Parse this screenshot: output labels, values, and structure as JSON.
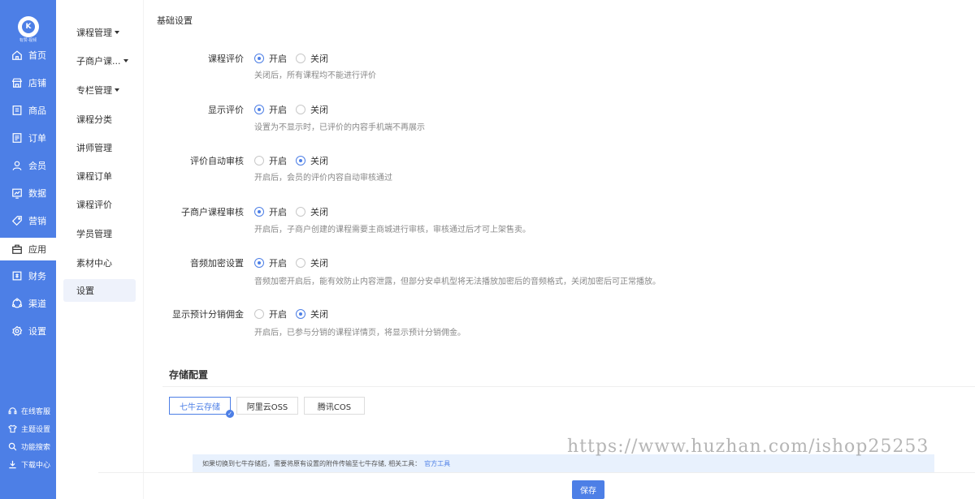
{
  "brand": {
    "logo_text": "有赞·视频",
    "logo_glyph": "K"
  },
  "primary_nav": [
    {
      "label": "首页",
      "icon": "home-icon"
    },
    {
      "label": "店铺",
      "icon": "store-icon"
    },
    {
      "label": "商品",
      "icon": "goods-icon"
    },
    {
      "label": "订单",
      "icon": "order-icon"
    },
    {
      "label": "会员",
      "icon": "member-icon"
    },
    {
      "label": "数据",
      "icon": "data-icon"
    },
    {
      "label": "营销",
      "icon": "tag-icon"
    },
    {
      "label": "应用",
      "icon": "app-icon"
    },
    {
      "label": "财务",
      "icon": "finance-icon"
    },
    {
      "label": "渠道",
      "icon": "channel-icon"
    },
    {
      "label": "设置",
      "icon": "gear-icon"
    }
  ],
  "bottom_nav": [
    {
      "label": "在线客服",
      "icon": "headset-icon"
    },
    {
      "label": "主题设置",
      "icon": "shirt-icon"
    },
    {
      "label": "功能搜索",
      "icon": "search-icon"
    },
    {
      "label": "下载中心",
      "icon": "download-icon"
    }
  ],
  "secondary_nav": [
    {
      "label": "课程管理"
    },
    {
      "label": "子商户课..."
    },
    {
      "label": "专栏管理"
    },
    {
      "label": "课程分类"
    },
    {
      "label": "讲师管理"
    },
    {
      "label": "课程订单"
    },
    {
      "label": "课程评价"
    },
    {
      "label": "学员管理"
    },
    {
      "label": "素材中心"
    },
    {
      "label": "设置"
    }
  ],
  "basic": {
    "title": "基础设置",
    "on_label": "开启",
    "off_label": "关闭",
    "rows": [
      {
        "label": "课程评价",
        "value": "开启",
        "hint": "关闭后，所有课程均不能进行评价"
      },
      {
        "label": "显示评价",
        "value": "开启",
        "hint": "设置为不显示时，已评价的内容手机端不再展示"
      },
      {
        "label": "评价自动审核",
        "value": "关闭",
        "hint": "开启后，会员的评价内容自动审核通过"
      },
      {
        "label": "子商户课程审核",
        "value": "开启",
        "hint": "开启后，子商户创建的课程需要主商城进行审核，审核通过后才可上架售卖。"
      },
      {
        "label": "音频加密设置",
        "value": "开启",
        "hint": "音频加密开启后，能有效防止内容泄露，但部分安卓机型将无法播放加密后的音频格式，关闭加密后可正常播放。"
      },
      {
        "label": "显示预计分销佣金",
        "value": "关闭",
        "hint": "开启后，已参与分销的课程详情页，将显示预计分销佣金。"
      }
    ]
  },
  "storage": {
    "title": "存储配置",
    "tabs": [
      "七牛云存储",
      "阿里云OSS",
      "腾讯COS"
    ],
    "selected": "七牛云存储",
    "notice": "如果切换到七牛存储后，需要将原有设置的附件传输至七牛存储, 相关工具：",
    "notice_link": "官方工具"
  },
  "save_label": "保存",
  "watermark": "https://www.huzhan.com/ishop25253",
  "colors": {
    "primary": "#4d7fe6",
    "notice_bg": "#e8f1fd"
  }
}
